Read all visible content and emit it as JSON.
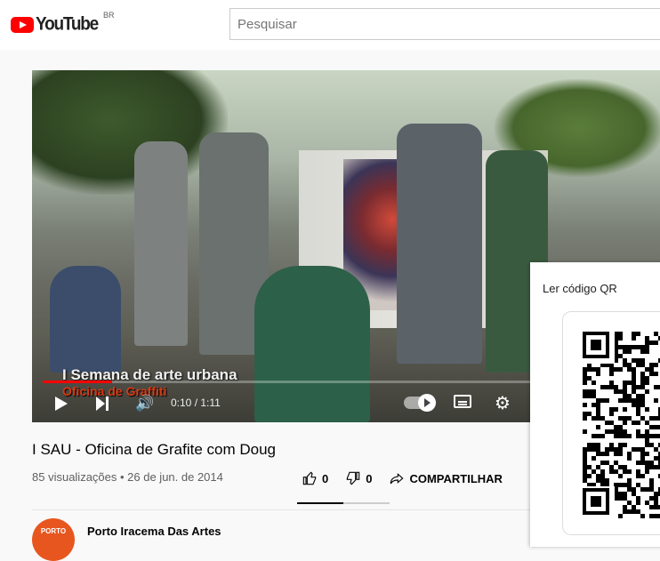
{
  "header": {
    "logo_text": "YouTube",
    "country": "BR",
    "search_placeholder": "Pesquisar"
  },
  "player": {
    "caption_line1": "I Semana de arte urbana",
    "caption_line2": "Oficina de Graffiti",
    "time": "0:10 / 1:11",
    "progress": 0.14
  },
  "video": {
    "title": "I SAU - Oficina de Grafite com Doug",
    "meta": "85 visualizações • 26 de jun. de 2014",
    "likes": "0",
    "dislikes": "0",
    "share_label": "COMPARTILHAR",
    "like_ratio": 0.5
  },
  "channel": {
    "avatar_text": "PORTO",
    "name": "Porto Iracema Das Artes"
  },
  "qr_panel": {
    "title": "Ler código QR"
  },
  "colors": {
    "accent": "#ff0000",
    "avatar": "#e8561f"
  }
}
